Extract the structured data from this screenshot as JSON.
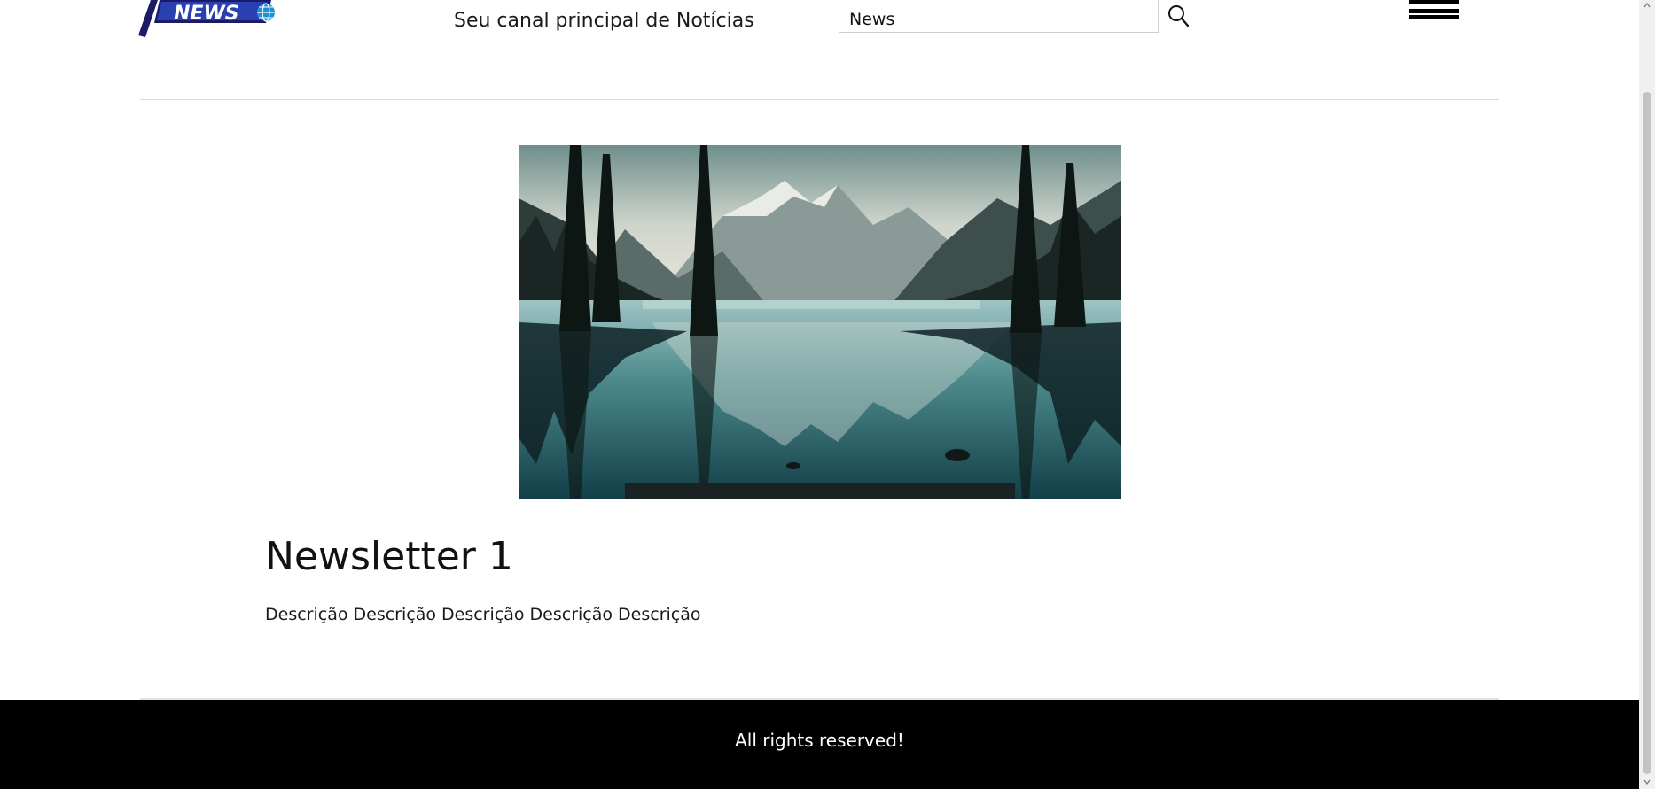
{
  "header": {
    "logo_text": "NEWS",
    "tagline": "Seu canal principal de Notícias",
    "search_value": "News",
    "search_icon": "search-icon",
    "menu_icon": "hamburger-menu-icon"
  },
  "article": {
    "title": "Newsletter 1",
    "description": "Descrição Descrição Descrição Descrição Descrição",
    "image_subject": "mountain-lake-landscape"
  },
  "footer": {
    "text": "All rights reserved!"
  },
  "colors": {
    "logo_navy": "#1c1a66",
    "logo_blue": "#1e90d6",
    "footer_bg": "#000000",
    "footer_text": "#ffffff"
  }
}
